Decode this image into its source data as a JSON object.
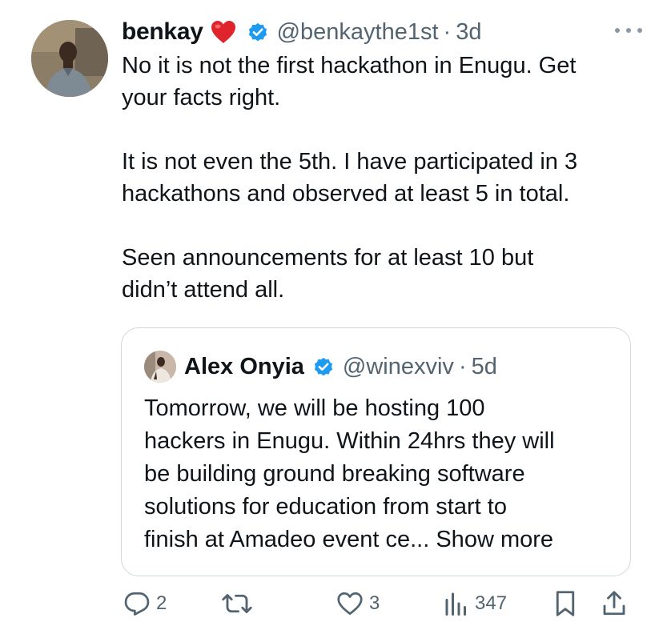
{
  "tweet": {
    "author_name": "benkay",
    "handle": "@benkaythe1st",
    "separator": "·",
    "time": "3d",
    "text": "No it is not the first hackathon in Enugu. Get\nyour facts right.\n\nIt is not even the 5th. I have participated in 3\nhackathons and observed at least 5 in total.\n\nSeen announcements for at least 10 but\ndidn’t attend all."
  },
  "quoted": {
    "author_name": "Alex Onyia",
    "handle": "@winexviv",
    "separator": "·",
    "time": "5d",
    "text": "Tomorrow, we will be hosting 100\nhackers in Enugu. Within 24hrs they will\nbe building ground breaking software\nsolutions for education from start to\nfinish at Amadeo event ce...",
    "show_more": "Show more"
  },
  "actions": {
    "replies": "2",
    "likes": "3",
    "views": "347"
  },
  "icons": {
    "heart": "red-heart-emoji",
    "verified": "blue-verified-badge",
    "more": "more-horizontal-icon",
    "reply": "reply-icon",
    "retweet": "retweet-icon",
    "like": "like-icon",
    "views": "views-icon",
    "bookmark": "bookmark-icon",
    "share": "share-icon"
  },
  "colors": {
    "text": "#0f1419",
    "secondary": "#536471",
    "verified": "#1d9bf0",
    "heart": "#e0242b",
    "border": "#cfd9de"
  }
}
